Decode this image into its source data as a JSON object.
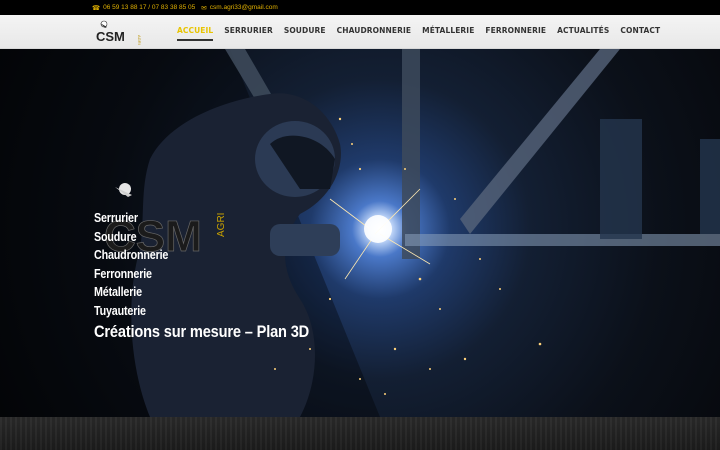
{
  "topbar": {
    "phone": "06 59 13 88 17 / 07 83 38 85 05",
    "email": "csm.agri33@gmail.com",
    "phone_icon": "phone-icon",
    "email_icon": "envelope-icon"
  },
  "header": {
    "logo_text": "CSM",
    "logo_sub": "AGRI",
    "nav": [
      {
        "label": "ACCUEIL",
        "active": true
      },
      {
        "label": "SERRURIER"
      },
      {
        "label": "SOUDURE"
      },
      {
        "label": "CHAUDRONNERIE"
      },
      {
        "label": "MÉTALLERIE"
      },
      {
        "label": "FERRONNERIE"
      },
      {
        "label": "ACTUALITÉS"
      },
      {
        "label": "CONTACT"
      }
    ]
  },
  "hero": {
    "logo_text": "CSM",
    "logo_sub": "AGRI",
    "lines": [
      "Serrurier",
      "Soudure",
      "Chaudronnerie",
      "Ferronnerie",
      "Métallerie",
      "Tuyauterie"
    ],
    "tagline": "Créations sur mesure – Plan 3D"
  },
  "colors": {
    "accent": "#e8c400",
    "topbar_bg": "#000000",
    "header_bg": "#f2f2f2"
  }
}
